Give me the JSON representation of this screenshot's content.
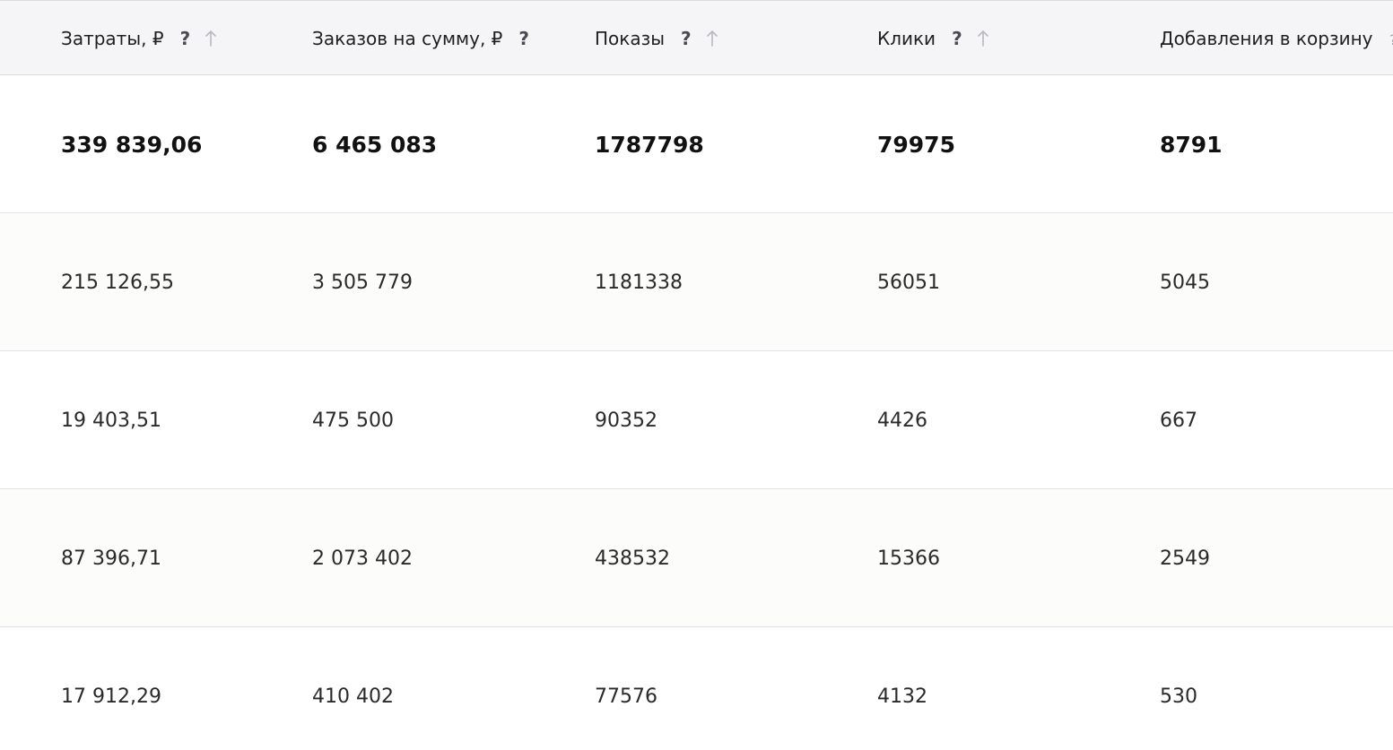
{
  "columns": [
    {
      "label": "Затраты, ₽",
      "help": "?",
      "sortable": true
    },
    {
      "label": "Заказов на сумму, ₽",
      "help": "?",
      "sortable": false
    },
    {
      "label": "Показы",
      "help": "?",
      "sortable": true
    },
    {
      "label": "Клики",
      "help": "?",
      "sortable": true
    },
    {
      "label": "Добавления в корзину",
      "help": "?",
      "sortable": false
    }
  ],
  "total_row": [
    "339 839,06",
    "6 465 083",
    "1787798",
    "79975",
    "8791"
  ],
  "rows": [
    [
      "215 126,55",
      "3 505 779",
      "1181338",
      "56051",
      "5045"
    ],
    [
      "19 403,51",
      "475 500",
      "90352",
      "4426",
      "667"
    ],
    [
      "87 396,71",
      "2 073 402",
      "438532",
      "15366",
      "2549"
    ],
    [
      "17 912,29",
      "410 402",
      "77576",
      "4132",
      "530"
    ]
  ],
  "colors": {
    "header_bg": "#f5f5f7",
    "alt_row_bg": "#fcfcfa",
    "border": "#e2e2e6",
    "sort_icon": "#b8b8c0"
  }
}
